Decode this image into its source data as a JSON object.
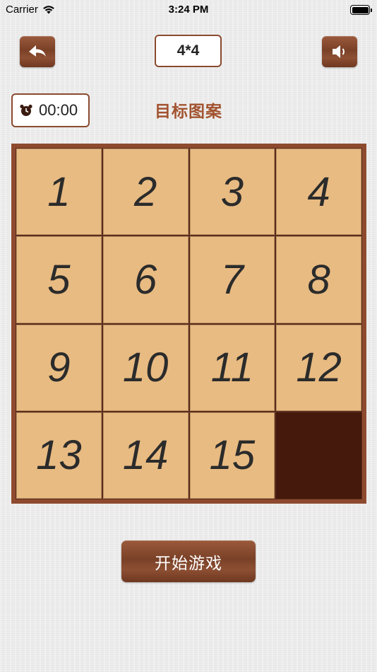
{
  "status_bar": {
    "carrier": "Carrier",
    "time": "3:24 PM"
  },
  "header": {
    "back_icon": "undo-arrow-icon",
    "size_label": "4*4",
    "sound_icon": "speaker-icon"
  },
  "timer": {
    "icon": "alarm-clock-icon",
    "value": "00:00"
  },
  "target_title": "目标图案",
  "board": {
    "size": 4,
    "tiles": [
      "1",
      "2",
      "3",
      "4",
      "5",
      "6",
      "7",
      "8",
      "9",
      "10",
      "11",
      "12",
      "13",
      "14",
      "15",
      ""
    ]
  },
  "start_button": {
    "label": "开始游戏"
  },
  "colors": {
    "wood": "#8e4a2e",
    "tile": "#e8bb82",
    "empty_tile": "#451a0d",
    "title": "#a2532f"
  }
}
